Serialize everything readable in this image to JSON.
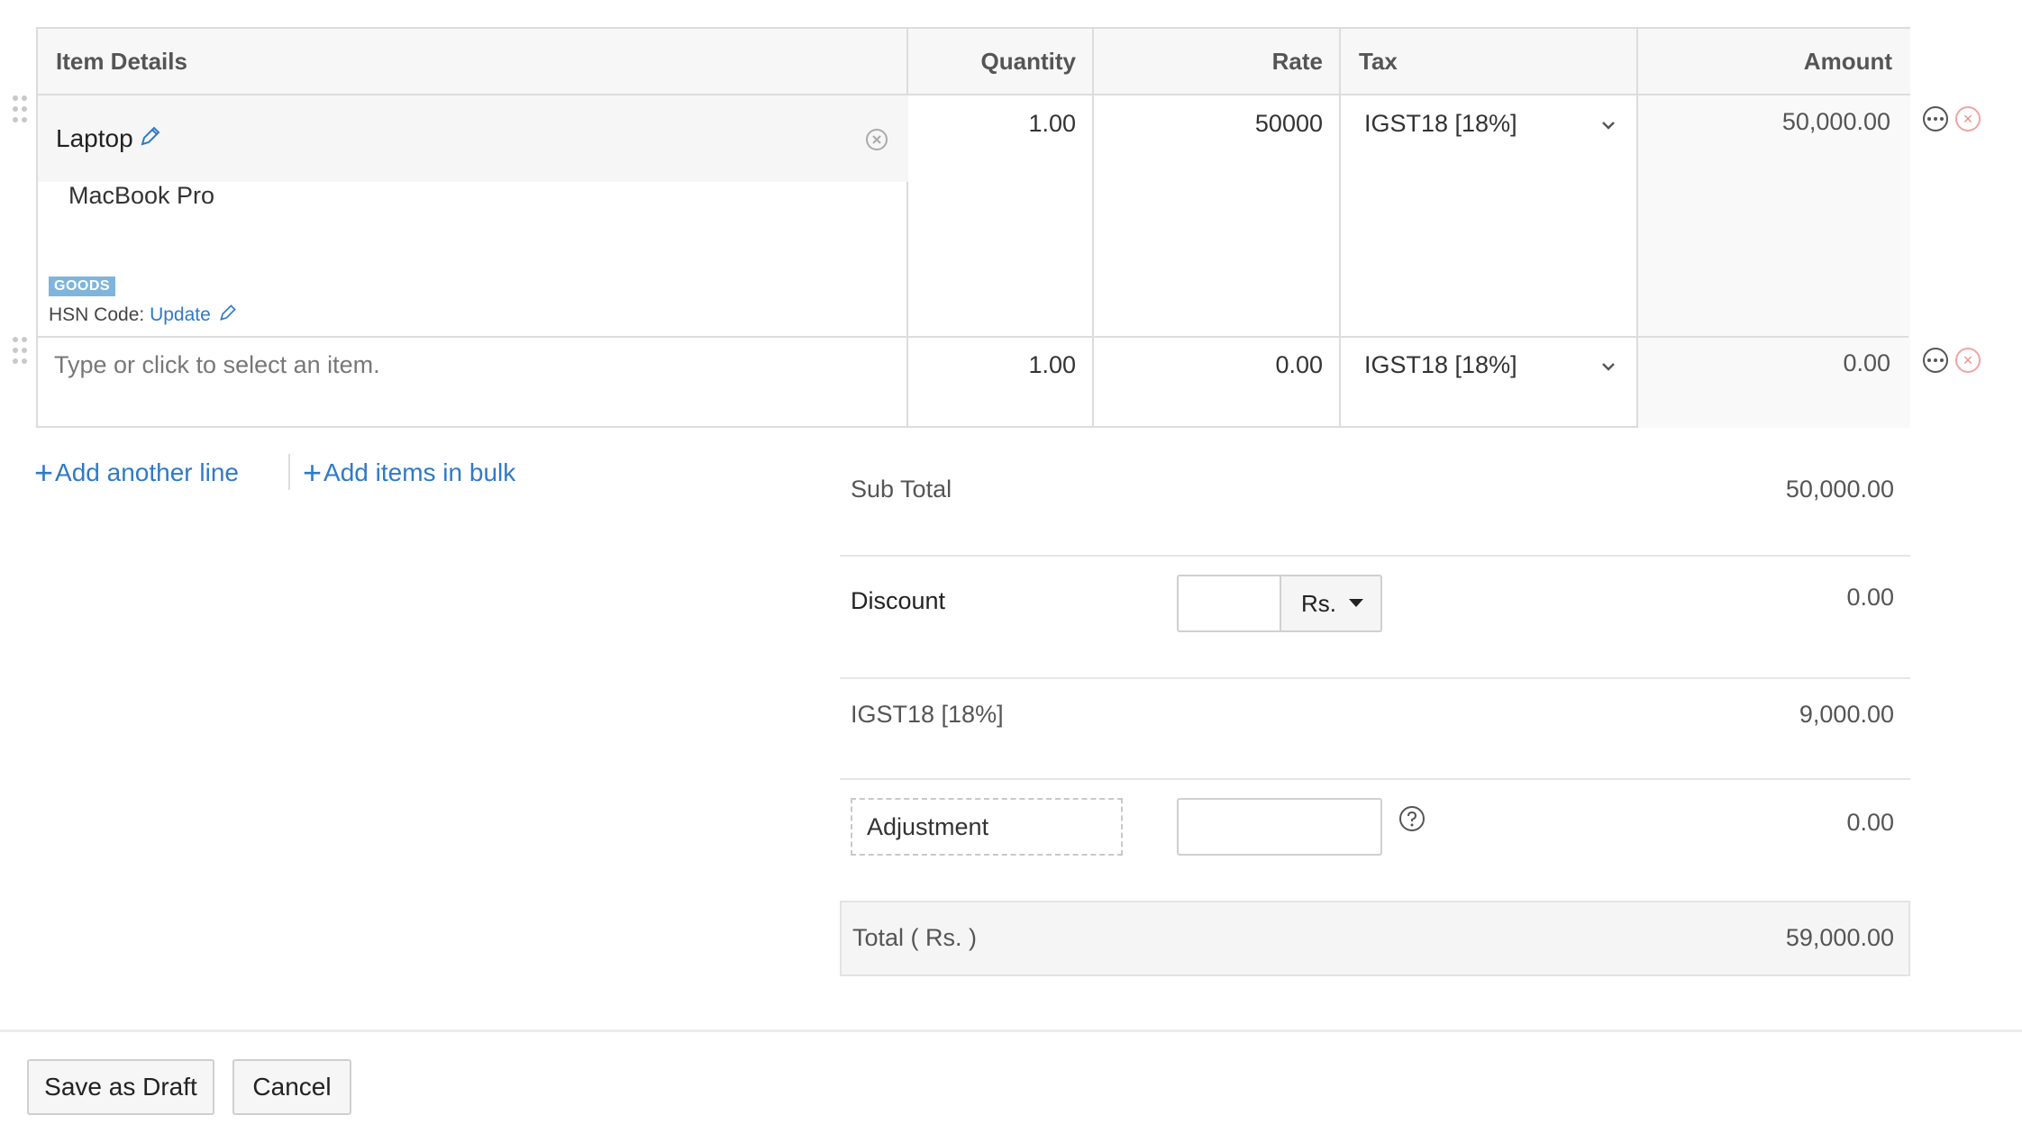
{
  "table": {
    "headers": {
      "item_details": "Item Details",
      "quantity": "Quantity",
      "rate": "Rate",
      "tax": "Tax",
      "amount": "Amount"
    },
    "rows": [
      {
        "item_name": "Laptop",
        "description": "MacBook Pro",
        "type_badge": "GOODS",
        "hsn_label": "HSN Code:",
        "hsn_link": "Update",
        "quantity": "1.00",
        "rate": "50000",
        "tax": "IGST18 [18%]",
        "amount": "50,000.00"
      },
      {
        "item_placeholder": "Type or click to select an item.",
        "quantity": "1.00",
        "rate": "0.00",
        "tax": "IGST18 [18%]",
        "amount": "0.00"
      }
    ]
  },
  "actions": {
    "add_line": "Add another line",
    "add_bulk": "Add items in bulk"
  },
  "totals": {
    "sub_total_label": "Sub Total",
    "sub_total_value": "50,000.00",
    "discount_label": "Discount",
    "discount_unit": "Rs.",
    "discount_value": "0.00",
    "tax_label": "IGST18 [18%]",
    "tax_value": "9,000.00",
    "adjustment_label": "Adjustment",
    "adjustment_value": "0.00",
    "total_label": "Total ( Rs. )",
    "total_value": "59,000.00"
  },
  "footer": {
    "save_draft": "Save as Draft",
    "cancel": "Cancel"
  },
  "colors": {
    "link": "#2f7ac6",
    "badge": "#7fb5dc",
    "remove": "#f08a8a"
  }
}
